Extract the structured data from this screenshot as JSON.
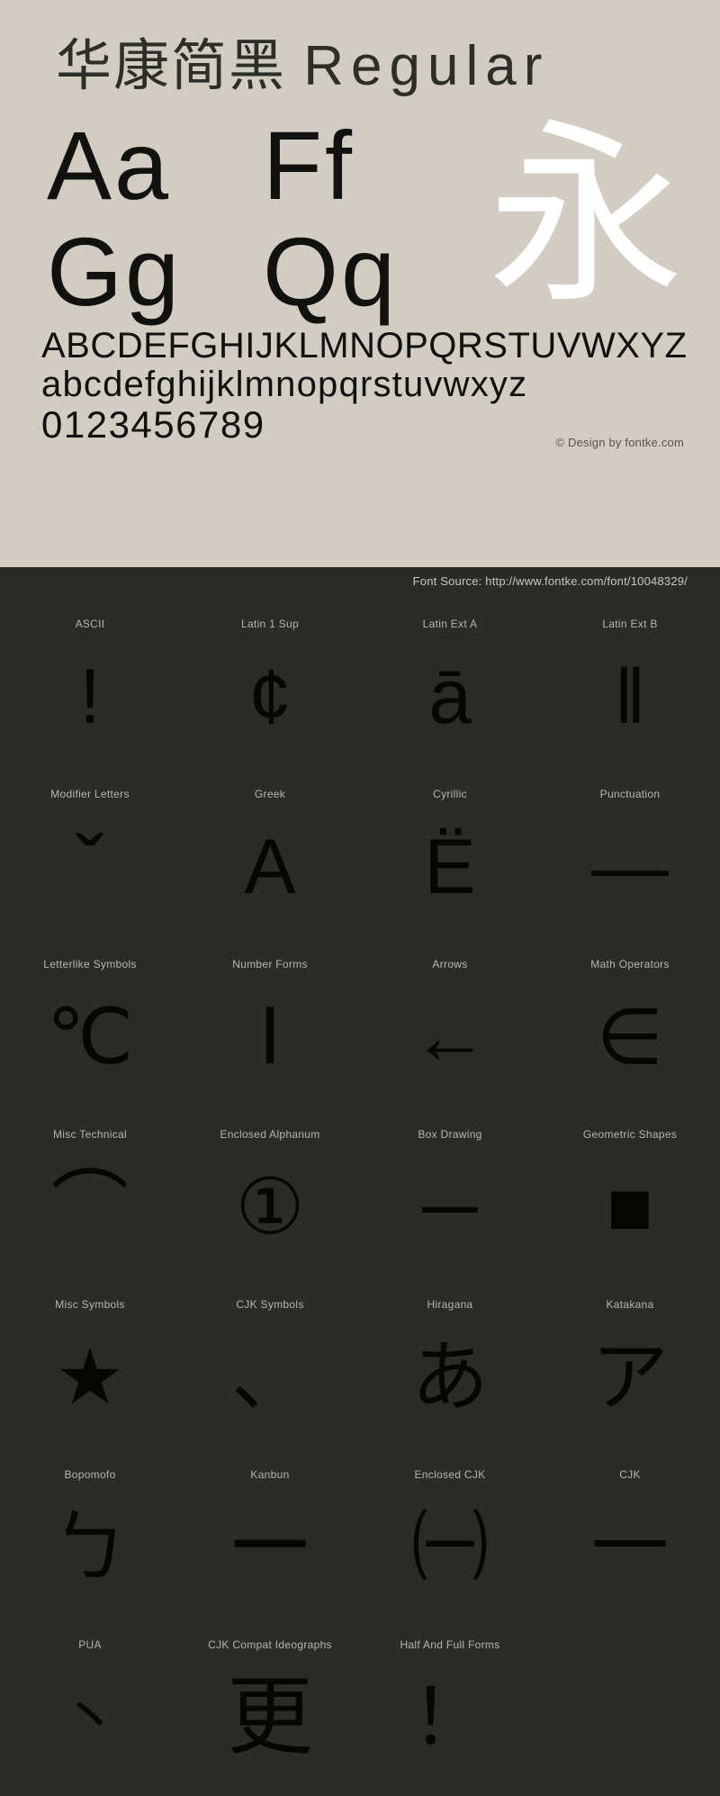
{
  "specimen": {
    "title_cjk": "华康简黑",
    "title_latin": "Regular",
    "pairs": [
      {
        "left": "Aa",
        "right": "Ff"
      },
      {
        "left": "Gg",
        "right": "Qq"
      }
    ],
    "showcase_glyph": "永",
    "uppercase": "ABCDEFGHIJKLMNOPQRSTUVWXYZ",
    "lowercase": "abcdefghijklmnopqrstuvwxyz",
    "digits": "0123456789",
    "copyright": "© Design by fontke.com",
    "colors": {
      "panel_background": "#d3ccc2",
      "text": "#111110",
      "showcase_glyph": "#ffffff",
      "copyright_text": "#55544e"
    }
  },
  "dark_section": {
    "font_source": "Font Source: http://www.fontke.com/font/10048329/",
    "colors": {
      "background": "#2b2b27",
      "label_text": "#b8b5ac",
      "glyph": "#060604",
      "source_text": "#c9c6bd"
    },
    "rows": [
      [
        {
          "label": "ASCII",
          "glyph": "!"
        },
        {
          "label": "Latin 1 Sup",
          "glyph": "¢"
        },
        {
          "label": "Latin Ext A",
          "glyph": "ā"
        },
        {
          "label": "Latin Ext B",
          "glyph": "ǁ"
        }
      ],
      [
        {
          "label": "Modifier Letters",
          "glyph": "ˇ"
        },
        {
          "label": "Greek",
          "glyph": "Α"
        },
        {
          "label": "Cyrillic",
          "glyph": "Ё"
        },
        {
          "label": "Punctuation",
          "glyph": "—"
        }
      ],
      [
        {
          "label": "Letterlike Symbols",
          "glyph": "℃"
        },
        {
          "label": "Number Forms",
          "glyph": "Ⅰ"
        },
        {
          "label": "Arrows",
          "glyph": "←"
        },
        {
          "label": "Math Operators",
          "glyph": "∈"
        }
      ],
      [
        {
          "label": "Misc Technical",
          "glyph": "⌒"
        },
        {
          "label": "Enclosed Alphanum",
          "glyph": "①"
        },
        {
          "label": "Box Drawing",
          "glyph": "─"
        },
        {
          "label": "Geometric Shapes",
          "glyph": "■"
        }
      ],
      [
        {
          "label": "Misc Symbols",
          "glyph": "★"
        },
        {
          "label": "CJK Symbols",
          "glyph": "、"
        },
        {
          "label": "Hiragana",
          "glyph": "あ"
        },
        {
          "label": "Katakana",
          "glyph": "ア"
        }
      ],
      [
        {
          "label": "Bopomofo",
          "glyph": "ㄅ"
        },
        {
          "label": "Kanbun",
          "glyph": "㆒"
        },
        {
          "label": "Enclosed CJK",
          "glyph": "㈠"
        },
        {
          "label": "CJK",
          "glyph": "一"
        }
      ],
      [
        {
          "label": "PUA",
          "glyph": "丶"
        },
        {
          "label": "CJK Compat Ideographs",
          "glyph": "更"
        },
        {
          "label": "Half And Full Forms",
          "glyph": "！"
        },
        {
          "label": "",
          "glyph": ""
        }
      ]
    ]
  }
}
